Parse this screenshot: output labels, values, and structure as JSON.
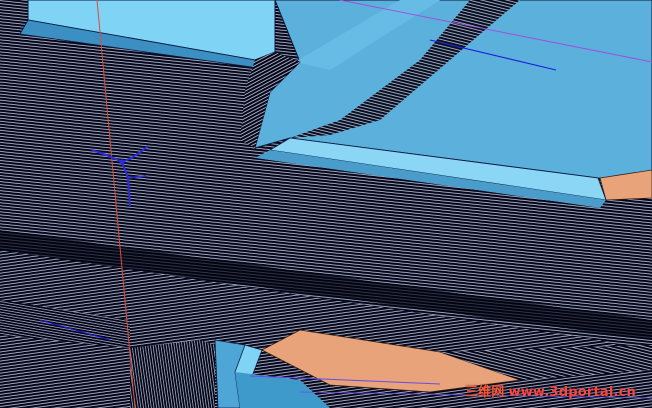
{
  "viewport": {
    "background": "#000000",
    "surface_color": "#5fb1dd",
    "toolpath_color": "#d8e2f0",
    "material_color": "#e8a37a",
    "axis_red_color": "#e04a3a",
    "axis_blue_color": "#1a1adc",
    "guide_purple_color": "#a050e0"
  },
  "triad": {
    "icon": "coordinate-triad-icon"
  },
  "watermark": {
    "chinese": "三维网",
    "url": "www.3dportal.cn",
    "color": "#ff4444"
  }
}
